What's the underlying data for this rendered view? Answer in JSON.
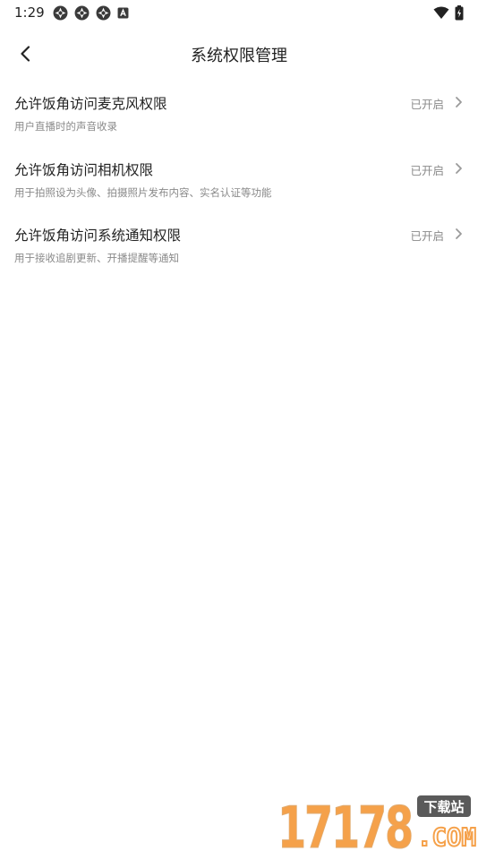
{
  "status_bar": {
    "time": "1:29",
    "notification_icons": [
      "app-notification-icon",
      "app-notification-icon",
      "app-notification-icon",
      "keyboard-notification-icon"
    ],
    "system_icons": [
      "wifi-icon",
      "battery-icon"
    ]
  },
  "nav": {
    "title": "系统权限管理",
    "back_icon": "chevron-left-icon"
  },
  "permissions": [
    {
      "title": "允许饭角访问麦克风权限",
      "description": "用户直播时的声音收录",
      "status": "已开启"
    },
    {
      "title": "允许饭角访问相机权限",
      "description": "用于拍照设为头像、拍摄照片发布内容、实名认证等功能",
      "status": "已开启"
    },
    {
      "title": "允许饭角访问系统通知权限",
      "description": "用于接收追剧更新、开播提醒等通知",
      "status": "已开启"
    }
  ],
  "watermark": {
    "number": "17178",
    "tag": "下载站",
    "domain": "COM"
  },
  "colors": {
    "primary_text": "#222222",
    "secondary_text": "#8a8a8a",
    "chevron": "#9a9a9a",
    "watermark_orange": "#f5a14a",
    "watermark_gray": "#5a5a5a"
  }
}
